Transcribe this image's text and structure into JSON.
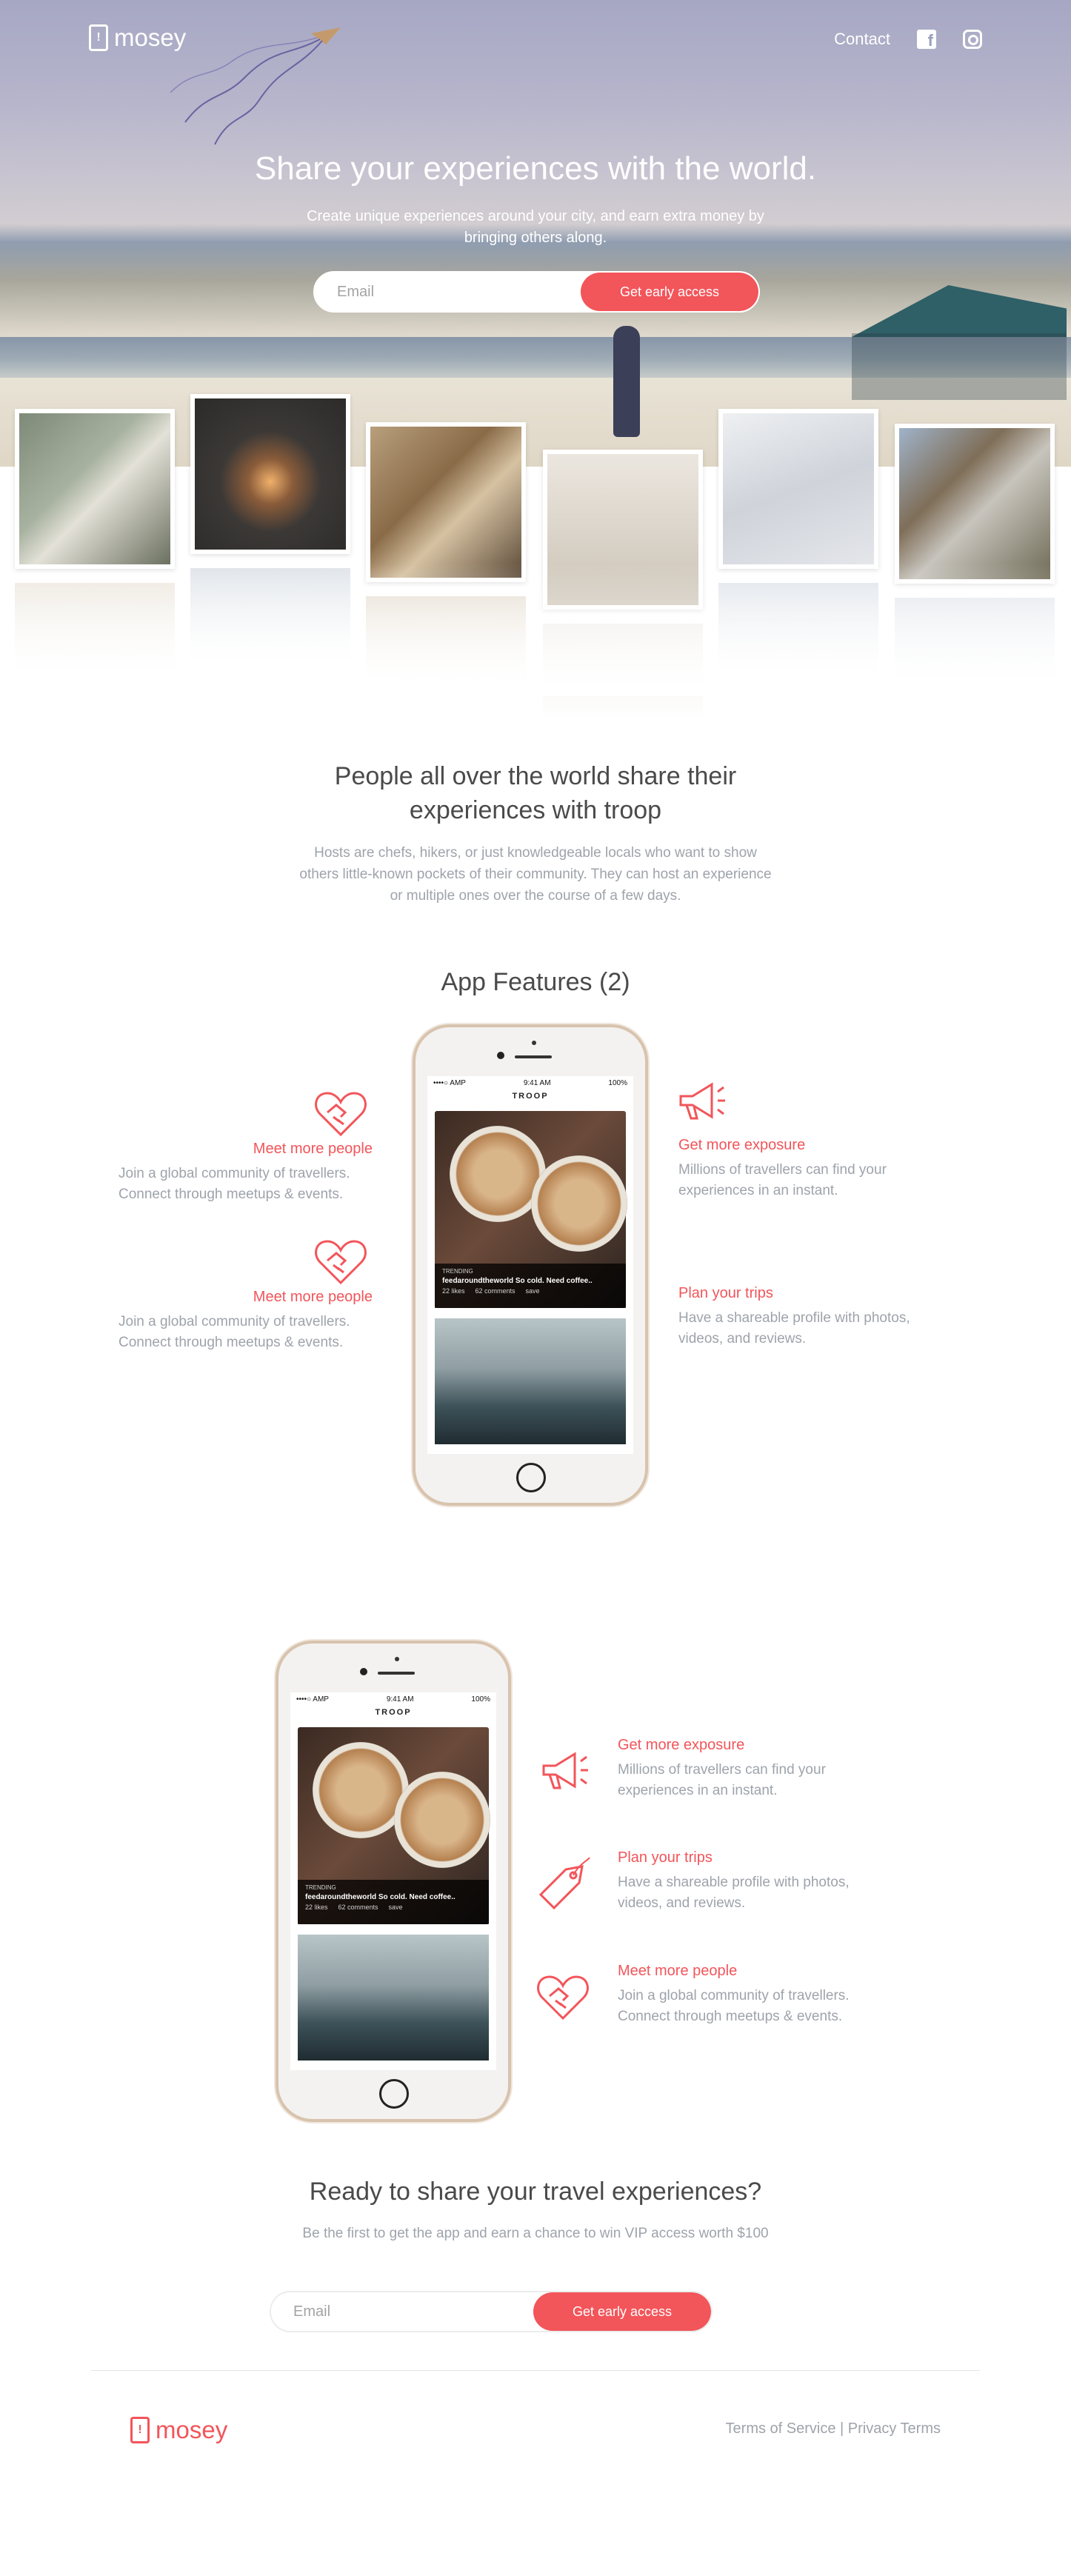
{
  "brand": {
    "name": "mosey",
    "accent": "#f2555a"
  },
  "nav": {
    "contact": "Contact",
    "icons": [
      "facebook-icon",
      "instagram-icon"
    ]
  },
  "hero": {
    "title": "Share your experiences with the world.",
    "subtitle": "Create unique experiences around your city, and earn extra money by bringing others along.",
    "email_placeholder": "Email",
    "cta": "Get early access"
  },
  "intro": {
    "title": "People all over the world share their experiences with troop",
    "text": "Hosts are chefs, hikers, or just knowledgeable locals who want to show others little-known pockets of their community. They can host an experience or multiple ones over the course of a few days."
  },
  "features_section": {
    "title": "App Features (2)",
    "left": [
      {
        "title": "Meet more people",
        "text": "Join a global community of travellers. Connect through meetups & events.",
        "icon": "handshake-heart-icon"
      },
      {
        "title": "Meet more people",
        "text": "Join a global community of travellers. Connect through meetups & events.",
        "icon": "handshake-heart-icon"
      }
    ],
    "right": [
      {
        "title": "Get more exposure",
        "text": "Millions of travellers can find  your experiences in an instant.",
        "icon": "megaphone-icon"
      },
      {
        "title": "Plan your trips",
        "text": "Have a shareable profile with photos, videos, and reviews."
      }
    ]
  },
  "features_section_2": [
    {
      "title": "Get more exposure",
      "text": "Millions of travellers can find  your experiences in an instant.",
      "icon": "megaphone-icon"
    },
    {
      "title": "Plan your trips",
      "text": "Have a shareable profile with photos, videos, and reviews.",
      "icon": "tag-icon"
    },
    {
      "title": "Meet more people",
      "text": "Join a global community of travellers. Connect through meetups & events.",
      "icon": "handshake-heart-icon"
    }
  ],
  "phone_screen": {
    "carrier": "••••○ AMP",
    "time": "9:41 AM",
    "battery": "100%",
    "app_name": "TROOP",
    "badge": "TRENDING",
    "caption": "feedaroundtheworld So cold. Need coffee..",
    "likes": "22 likes",
    "comments": "62 comments",
    "save": "save"
  },
  "ready": {
    "title": "Ready to share your travel experiences?",
    "subtitle": "Be the first to get the app and earn a chance to win VIP access worth $100",
    "email_placeholder": "Email",
    "cta": "Get early access"
  },
  "footer": {
    "terms": "Terms of Service",
    "separator": " | ",
    "privacy": "Privacy Terms"
  }
}
